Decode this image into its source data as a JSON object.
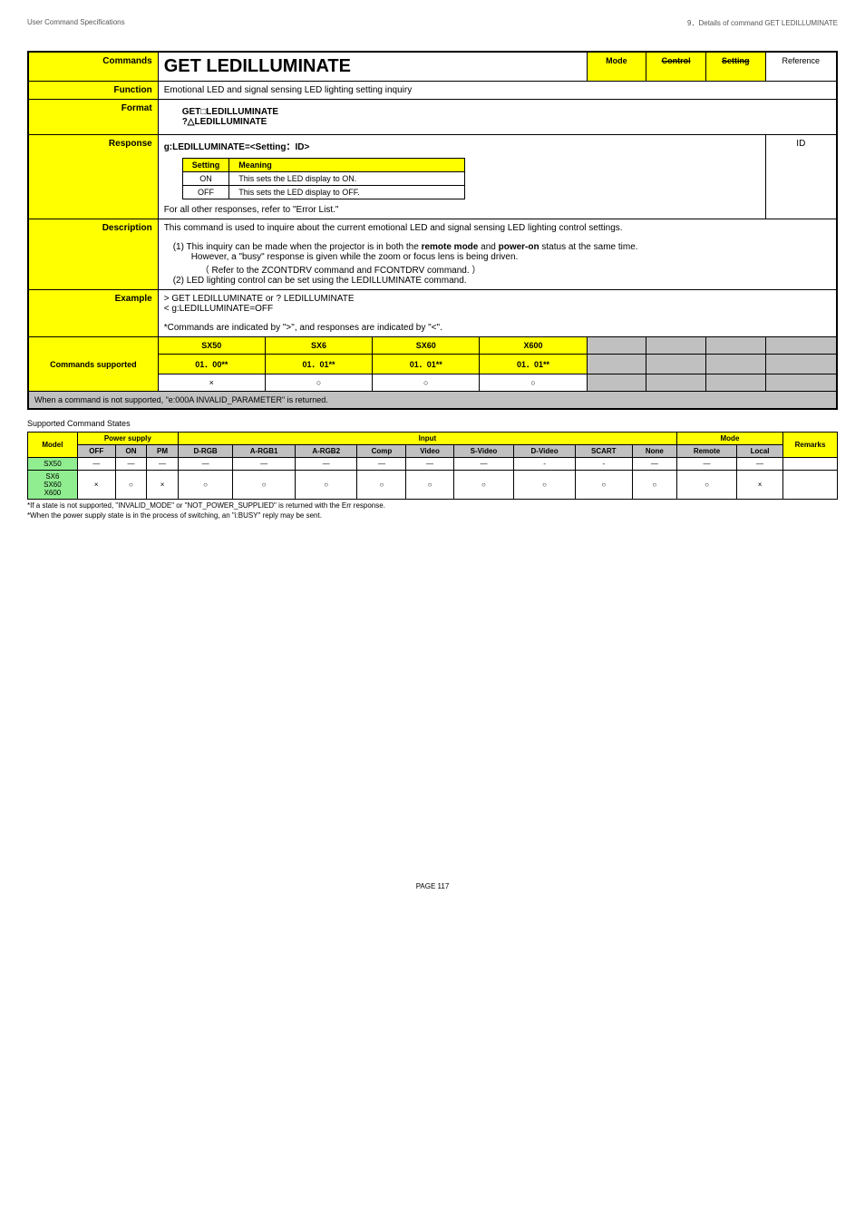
{
  "header": {
    "left": "User Command Specifications",
    "right": "9．Details of command GET LEDILLUMINATE"
  },
  "labels": {
    "commands": "Commands",
    "function": "Function",
    "format": "Format",
    "response": "Response",
    "description": "Description",
    "example": "Example",
    "commands_supported": "Commands supported",
    "mode": "Mode",
    "control": "Control",
    "setting": "Setting",
    "reference": "Reference"
  },
  "command_name": "GET LEDILLUMINATE",
  "function_text": "Emotional LED and signal sensing LED lighting setting inquiry",
  "format_lines": [
    "GET□LEDILLUMINATE",
    "?△LEDILLUMINATE"
  ],
  "response": {
    "line1": "g:LEDILLUMINATE=<Setting：ID>",
    "table_head": {
      "c1": "Setting",
      "c2": "Meaning"
    },
    "rows": [
      {
        "c1": "ON",
        "c2": "This sets the LED display to ON."
      },
      {
        "c1": "OFF",
        "c2": "This sets the LED display to OFF."
      }
    ],
    "footer": "For all other responses, refer to \"Error List.\"",
    "id_label": "ID"
  },
  "description": {
    "intro": "This command is used to inquire about the current emotional LED and signal sensing LED lighting control settings.",
    "p1": "(1) This inquiry can be made when the projector is in both the remote mode and power-on status at the same time.",
    "p1b": "However, a \"busy\" response is given while the zoom or focus lens is being driven.",
    "p1c": "（ Refer to the ZCONTDRV command and FCONTDRV command. ）",
    "p2": "(2) LED lighting control can be set using the LEDILLUMINATE command."
  },
  "example": {
    "l1": "> GET LEDILLUMINATE or ? LEDILLUMINATE",
    "l2": "< g:LEDILLUMINATE=OFF",
    "note": "*Commands are indicated by \">\", and responses are indicated by \"<\"."
  },
  "supported": {
    "columns": [
      "SX50",
      "SX6",
      "SX60",
      "X600"
    ],
    "versions": [
      "01．00**",
      "01．01**",
      "01．01**",
      "01．01**"
    ],
    "marks": [
      "×",
      "○",
      "○",
      "○"
    ],
    "note": "When a command is not supported, \"e:000A INVALID_PARAMETER\" is returned."
  },
  "states": {
    "title": "Supported Command States",
    "head": {
      "model": "Model",
      "power": "Power supply",
      "input": "Input",
      "mode": "Mode",
      "remarks": "Remarks",
      "off": "OFF",
      "on": "ON",
      "pm": "PM",
      "drgb": "D-RGB",
      "argb1": "A-RGB1",
      "argb2": "A-RGB2",
      "comp": "Comp",
      "video": "Video",
      "svideo": "S-Video",
      "dvideo": "D-Video",
      "scart": "SCART",
      "none": "None",
      "remote": "Remote",
      "local": "Local"
    },
    "rows": [
      {
        "model": "SX50",
        "cells": [
          "―",
          "―",
          "―",
          "―",
          "―",
          "―",
          "―",
          "―",
          "―",
          "-",
          "-",
          "―",
          "―",
          "―"
        ],
        "remarks": ""
      },
      {
        "model": "SX6\nSX60\nX600",
        "cells": [
          "×",
          "○",
          "×",
          "○",
          "○",
          "○",
          "○",
          "○",
          "○",
          "○",
          "○",
          "○",
          "○",
          "×"
        ],
        "remarks": ""
      }
    ],
    "foot1": "*If a state is not supported, \"INVALID_MODE\" or \"NOT_POWER_SUPPLIED\" is returned with the Err response.",
    "foot2": "*When the power supply state is in the process of switching, an \"i:BUSY\" reply may be sent."
  },
  "page": "PAGE 117"
}
